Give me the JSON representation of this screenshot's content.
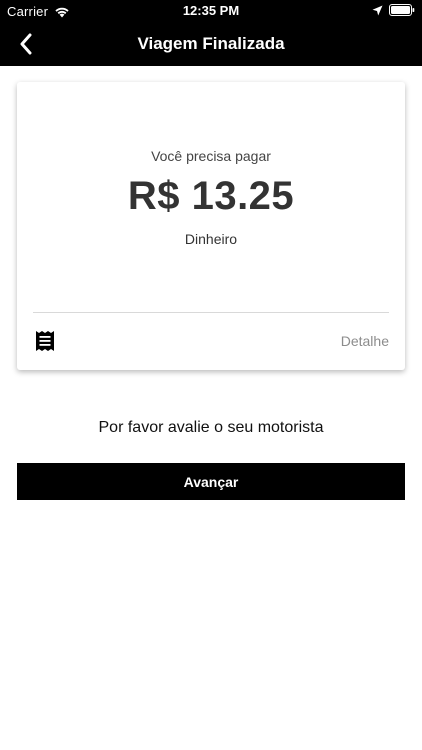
{
  "status_bar": {
    "carrier": "Carrier",
    "time": "12:35 PM",
    "icons": [
      "wifi-icon",
      "location-icon",
      "battery-icon"
    ]
  },
  "nav": {
    "title": "Viagem Finalizada",
    "back_icon": "chevron-left-icon"
  },
  "payment_card": {
    "caption": "Você precisa pagar",
    "amount": "R$ 13.25",
    "method": "Dinheiro",
    "receipt_icon": "receipt-icon",
    "detail_label": "Detalhe"
  },
  "rating": {
    "prompt": "Por favor avalie o seu motorista"
  },
  "actions": {
    "next_label": "Avançar"
  },
  "colors": {
    "bar_background": "#000000",
    "bar_text": "#ffffff",
    "button_background": "#000000",
    "amount_text": "#333333",
    "detail_text": "#8c8c8c"
  }
}
